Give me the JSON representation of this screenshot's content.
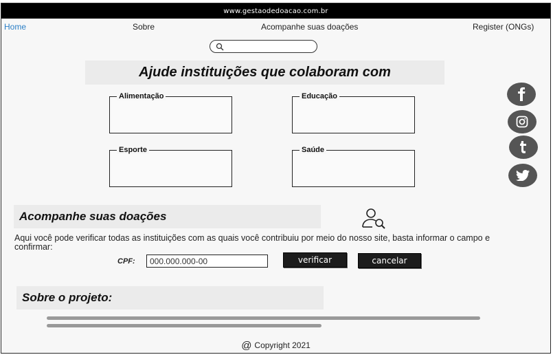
{
  "browser": {
    "url": "www.gestaodedoacao.com.br"
  },
  "nav": {
    "home": "Home",
    "sobre": "Sobre",
    "acompanhe": "Acompanhe suas doações",
    "register": "Register (ONGs)",
    "active_color": "#2b7fc6"
  },
  "search": {
    "value": "",
    "placeholder": "",
    "icon": "search-icon"
  },
  "hero": {
    "title": "Ajude instituições que colaboram com"
  },
  "categories": [
    {
      "label": "Alimentação"
    },
    {
      "label": "Educação"
    },
    {
      "label": "Esporte"
    },
    {
      "label": "Saúde"
    }
  ],
  "social": [
    "facebook-icon",
    "instagram-icon",
    "tumblr-icon",
    "twitter-icon"
  ],
  "tracking": {
    "title": "Acompanhe suas doações",
    "icon": "user-search-icon",
    "description": "Aqui você pode verificar todas as instituições com as quais você contribuiu por meio do nosso site, basta informar o campo e confirmar:",
    "cpf_label": "CPF:",
    "cpf_value": "000.000.000-00",
    "verify_label": "verificar",
    "cancel_label": "cancelar"
  },
  "about": {
    "title": "Sobre o projeto:"
  },
  "footer": {
    "copyright": "Copyright 2021",
    "symbol": "@"
  }
}
